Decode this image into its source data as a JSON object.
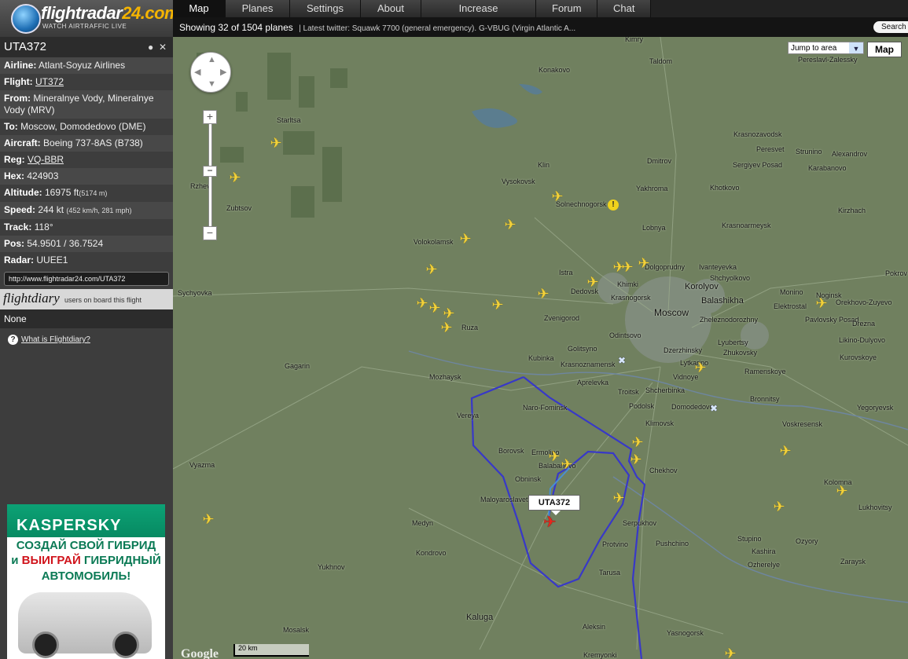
{
  "logo": {
    "name_a": "flightradar",
    "name_b": "24.com",
    "tagline": "WATCH AIRTRAFFIC LIVE"
  },
  "nav": {
    "tabs": [
      "Map",
      "Planes",
      "Settings",
      "About",
      "Increase coverage",
      "Forum",
      "Chat"
    ],
    "active": "Map"
  },
  "status": {
    "count": "Showing 32 of 1504 planes",
    "twitter": "| Latest twitter: Squawk 7700 (general emergency). G-VBUG (Virgin Atlantic A...",
    "search": "Search"
  },
  "flight": {
    "callsign": "UTA372",
    "rows": [
      {
        "label": "Airline:",
        "value": "Atlant-Soyuz Airlines"
      },
      {
        "label": "Flight:",
        "value": "UT372"
      },
      {
        "label": "From:",
        "value": "Mineralnye Vody, Mineralnye Vody (MRV)"
      },
      {
        "label": "To:",
        "value": "Moscow, Domodedovo (DME)"
      },
      {
        "label": "Aircraft:",
        "value": "Boeing 737-8AS (B738)"
      },
      {
        "label": "Reg:",
        "value": "VQ-BBR"
      },
      {
        "label": "Hex:",
        "value": "424903"
      },
      {
        "label": "Altitude:",
        "value": "16975 ft",
        "extra": "(5174 m)"
      },
      {
        "label": "Speed:",
        "value": "244 kt",
        "extra": "(452 km/h, 281 mph)"
      },
      {
        "label": "Track:",
        "value": "118°"
      },
      {
        "label": "Pos:",
        "value": "54.9501 / 36.7524"
      },
      {
        "label": "Radar:",
        "value": "UUEE1"
      }
    ],
    "url": "http://www.flightradar24.com/UTA372"
  },
  "flightdiary": {
    "brand": "flightdiary",
    "subtitle": "users on board this flight",
    "none": "None",
    "what": "What is Flightdiary?"
  },
  "ad": {
    "brand": "KASPERSKY",
    "line1": "СОЗДАЙ СВОЙ ГИБРИД",
    "line2a": "и ",
    "line2b": "ВЫИГРАЙ",
    "line2c": " ГИБРИДНЫЙ",
    "line3": "АВТОМОБИЛЬ!"
  },
  "map": {
    "jump": "Jump to area",
    "type": "Map",
    "scale": "20 km",
    "google": "Google",
    "selected_label": "UTA372",
    "places": [
      "Kimry",
      "Taldom",
      "Pereslavl-Zalessky",
      "Konakovo",
      "Starltsa",
      "Krasnozavodsk",
      "Peresvet",
      "Strunino",
      "Alexandrov",
      "Sergiyev Posad",
      "Karabanovo",
      "Dmitrov",
      "Klin",
      "Vysokovsk",
      "Yakhroma",
      "Khotkovo",
      "Solnechnogorsk",
      "Kirzhach",
      "Rzhev",
      "Zubtsov",
      "Krasnoarmeysk",
      "Volokolamsk",
      "Lobnya",
      "Dolgoprudny",
      "Istra",
      "Khimki",
      "Korolyov",
      "Ivanteyevka",
      "Shchyolkovo",
      "Sychyovka",
      "Dedovsk",
      "Krasnogorsk",
      "Balashikha",
      "Noginsk",
      "Monino",
      "Pokrov",
      "Elektrostal",
      "Orekhovo-Zuyevo",
      "Moscow",
      "Zheleznodorozhny",
      "Pavlovsky Posad",
      "Drezna",
      "Zvenigorod",
      "Ruza",
      "Odintsovo",
      "Lyubertsy",
      "Likino-Dulyovo",
      "Golitsyno",
      "Dzerzhinsky",
      "Zhukovsky",
      "Kurovskoye",
      "Gagarin",
      "Kubinka",
      "Krasnoznamensk",
      "Lytkarino",
      "Ramenskoye",
      "Mozhaysk",
      "Aprelevka",
      "Vidnoye",
      "Troitsk",
      "Shcherbinka",
      "Bronnitsy",
      "Podolsk",
      "Domodedovo",
      "Yegoryevsk",
      "Vereya",
      "Naro-Fominsk",
      "Klimovsk",
      "Voskresensk",
      "Borovsk",
      "Ermolino",
      "Balabanovo",
      "Chekhov",
      "Vyazma",
      "Obninsk",
      "Kolomna",
      "Maloyaroslavets",
      "Lukhovitsy",
      "Serpukhov",
      "Medyn",
      "Pushchino",
      "Stupino",
      "Kondrovo",
      "Protvino",
      "Ozyory",
      "Kashira",
      "Zaraysk",
      "Tarusa",
      "Ozherelye",
      "Yukhnov",
      "Kaluga",
      "Aleksin",
      "Mosalsk",
      "Yasnogorsk",
      "Kremyonki"
    ]
  }
}
